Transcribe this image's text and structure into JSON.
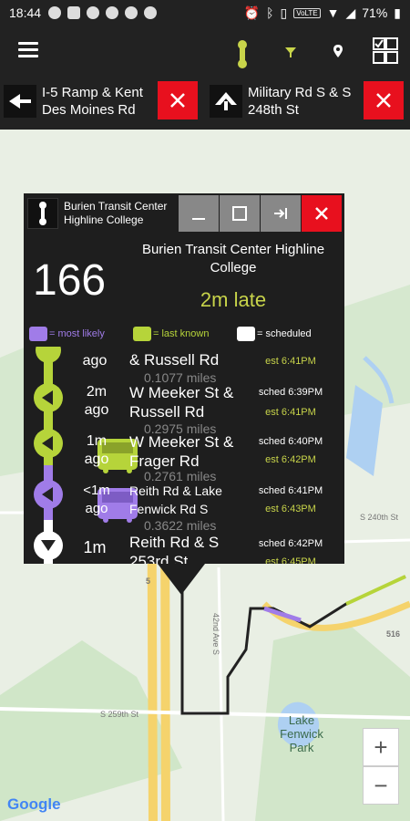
{
  "status": {
    "time": "18:44",
    "battery": "71%",
    "network": "VoLTE"
  },
  "appbar": {
    "menu_icon": "hamburger-icon",
    "icons": [
      "bus-stop-icon",
      "filter-icon",
      "location-pin-icon",
      "grid-view-icon"
    ]
  },
  "stop_tabs": [
    {
      "name": "I-5 Ramp & Kent Des Moines Rd",
      "close": "close-icon"
    },
    {
      "name": "Military Rd S & S 248th St",
      "close": "close-icon"
    }
  ],
  "popup": {
    "stop_name": "Burien Transit Center Highline College",
    "route": "166",
    "destination": "Burien Transit Center Highline College",
    "status": "2m late",
    "legend": [
      {
        "label": "= most likely",
        "color": "#a07ce8"
      },
      {
        "label": "= last known",
        "color": "#b6d43a"
      },
      {
        "label": "= scheduled",
        "color": "#ffffff"
      }
    ],
    "rows": [
      {
        "ago": "ago",
        "stop": "& Russell Rd",
        "miles": "0.1077 miles",
        "sched": "",
        "est": "est 6:41PM"
      },
      {
        "ago": "2m ago",
        "stop": "W Meeker St & Russell Rd",
        "miles": "0.2975 miles",
        "sched": "sched 6:39PM",
        "est": "est 6:41PM"
      },
      {
        "ago": "1m ago",
        "stop": "W Meeker St & Frager Rd",
        "miles": "0.2761 miles",
        "sched": "sched 6:40PM",
        "est": "est 6:42PM"
      },
      {
        "ago": "<1m ago",
        "stop": "Reith Rd & Lake Fenwick Rd S",
        "miles": "0.3622 miles",
        "sched": "sched 6:41PM",
        "est": "est 6:43PM"
      },
      {
        "ago": "1m",
        "stop": "Reith Rd & S 253rd St",
        "miles": "",
        "sched": "sched 6:42PM",
        "est": "est 6:45PM"
      }
    ]
  },
  "map": {
    "labels": {
      "lake": "Lake Fenwick Park",
      "highway_5": "5",
      "highway_516": "516",
      "ave": "42nd Ave S",
      "street": "S 259th St",
      "street2": "S 240th St"
    },
    "zoom_in": "+",
    "zoom_out": "−",
    "attribution": "Google"
  }
}
